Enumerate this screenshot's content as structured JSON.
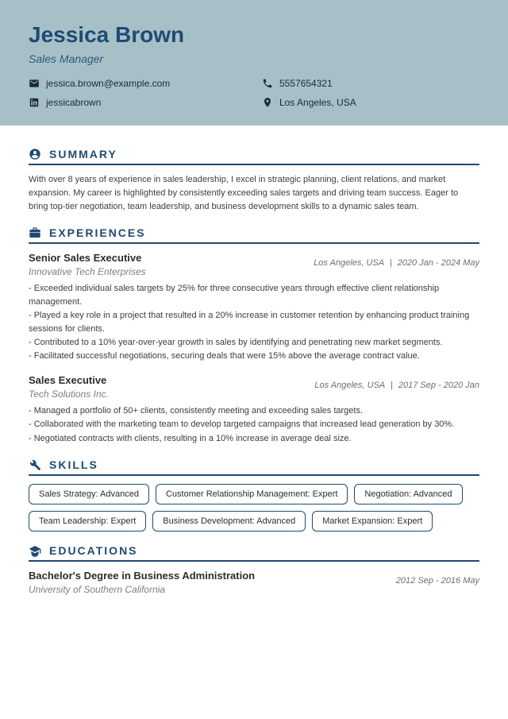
{
  "header": {
    "name": "Jessica Brown",
    "title": "Sales Manager",
    "contacts": {
      "email": "jessica.brown@example.com",
      "phone": "5557654321",
      "linkedin": "jessicabrown",
      "location": "Los Angeles, USA"
    }
  },
  "sections": {
    "summary": {
      "title": "SUMMARY",
      "text": "With over 8 years of experience in sales leadership, I excel in strategic planning, client relations, and market expansion. My career is highlighted by consistently exceeding sales targets and driving team success. Eager to bring top-tier negotiation, team leadership, and business development skills to a dynamic sales team."
    },
    "experiences": {
      "title": "EXPERIENCES",
      "items": [
        {
          "role": "Senior Sales Executive",
          "company": "Innovative Tech Enterprises",
          "location": "Los Angeles, USA",
          "dates": "2020 Jan - 2024 May",
          "bullets": [
            "- Exceeded individual sales targets by 25% for three consecutive years through effective client relationship management.",
            "- Played a key role in a project that resulted in a 20% increase in customer retention by enhancing product training sessions for clients.",
            "- Contributed to a 10% year-over-year growth in sales by identifying and penetrating new market segments.",
            "- Facilitated successful negotiations, securing deals that were 15% above the average contract value."
          ]
        },
        {
          "role": "Sales Executive",
          "company": "Tech Solutions Inc.",
          "location": "Los Angeles, USA",
          "dates": "2017 Sep - 2020 Jan",
          "bullets": [
            "- Managed a portfolio of 50+ clients, consistently meeting and exceeding sales targets.",
            "- Collaborated with the marketing team to develop targeted campaigns that increased lead generation by 30%.",
            "- Negotiated contracts with clients, resulting in a 10% increase in average deal size."
          ]
        }
      ]
    },
    "skills": {
      "title": "SKILLS",
      "items": [
        "Sales Strategy: Advanced",
        "Customer Relationship Management: Expert",
        "Negotiation: Advanced",
        "Team Leadership: Expert",
        "Business Development: Advanced",
        "Market Expansion: Expert"
      ]
    },
    "educations": {
      "title": "EDUCATIONS",
      "items": [
        {
          "degree": "Bachelor's Degree in Business Administration",
          "school": "University of Southern California",
          "dates": "2012 Sep - 2016 May"
        }
      ]
    }
  }
}
